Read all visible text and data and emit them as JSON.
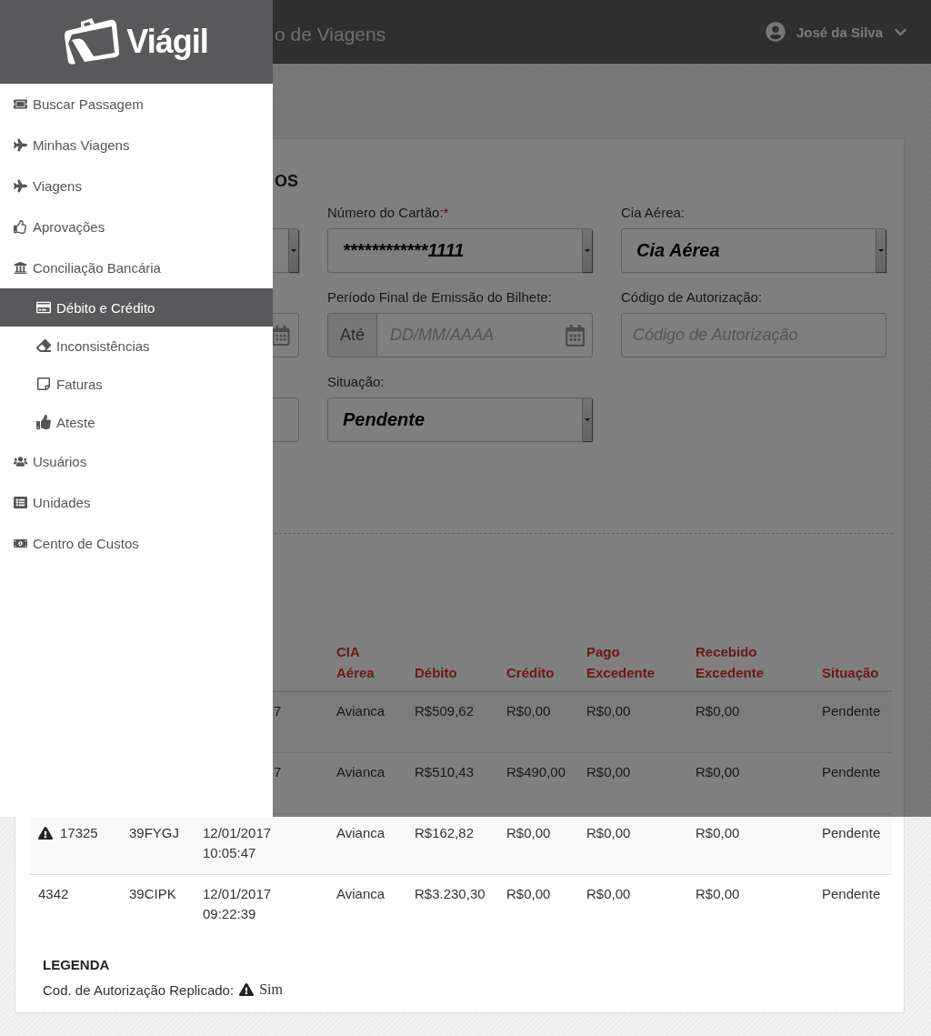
{
  "header": {
    "title": "o de Viagens",
    "user": "José da Silva"
  },
  "sidebar": {
    "logo": "Viágil",
    "items": [
      {
        "label": "Buscar Passagem",
        "selected": false
      },
      {
        "label": "Minhas Viagens",
        "selected": false
      },
      {
        "label": "Viagens",
        "selected": false
      },
      {
        "label": "Aprovações",
        "selected": false
      },
      {
        "label": "Conciliação Bancária",
        "selected": false,
        "children": [
          {
            "label": "Débito e Crédito",
            "selected": true
          },
          {
            "label": "Inconsistências",
            "selected": false
          },
          {
            "label": "Faturas",
            "selected": false
          },
          {
            "label": "Ateste",
            "selected": false
          }
        ]
      },
      {
        "label": "Usuários",
        "selected": false
      },
      {
        "label": "Unidades",
        "selected": false
      },
      {
        "label": "Centro de Custos",
        "selected": false
      }
    ]
  },
  "filters": {
    "heading": "OS",
    "rows": [
      [
        {
          "kind": "select",
          "label": "Número do Cartão:",
          "required_mark": "*",
          "value": "************1111"
        },
        {
          "kind": "select",
          "label": "Cia Aérea:",
          "value": "Cia Aérea"
        }
      ],
      [
        {
          "kind": "date",
          "label": "Período Final de Emissão do Bilhete:",
          "prefix": "Até",
          "placeholder": "DD/MM/AAAA"
        },
        {
          "kind": "text",
          "label": "Código de Autorização:",
          "placeholder": "Código de Autorização"
        }
      ],
      [
        {
          "kind": "select",
          "label": "Situação:",
          "value": "Pendente"
        }
      ]
    ]
  },
  "table": {
    "columns": [
      "CIA Aérea",
      "Débito",
      "Crédito",
      "Pago Excedente",
      "Recebido Excedente",
      "Situação"
    ],
    "rows": [
      {
        "date": "7",
        "airline": "Avianca",
        "debit": "R$509,62",
        "credit": "R$0,00",
        "paid_excess": "R$0,00",
        "received_excess": "R$0,00",
        "status": "Pendente"
      },
      {
        "date": "7",
        "airline": "Avianca",
        "debit": "R$510,43",
        "credit": "R$490,00",
        "paid_excess": "R$0,00",
        "received_excess": "R$0,00",
        "status": "Pendente"
      },
      {
        "replicated": true,
        "id": "17325",
        "code": "39FYGJ",
        "date": "12/01/2017",
        "time": "10:05:47",
        "airline": "Avianca",
        "debit": "R$162,82",
        "credit": "R$0,00",
        "paid_excess": "R$0,00",
        "received_excess": "R$0,00",
        "status": "Pendente"
      },
      {
        "replicated": false,
        "id": "4342",
        "code": "39CIPK",
        "date": "12/01/2017",
        "time": "09:22:39",
        "airline": "Avianca",
        "debit": "R$3.230,30",
        "credit": "R$0,00",
        "paid_excess": "R$0,00",
        "received_excess": "R$0,00",
        "status": "Pendente"
      }
    ]
  },
  "legend": {
    "title": "LEGENDA",
    "items": [
      {
        "label": "Cod. de Autorização Replicado:",
        "value": "Sim"
      }
    ]
  }
}
